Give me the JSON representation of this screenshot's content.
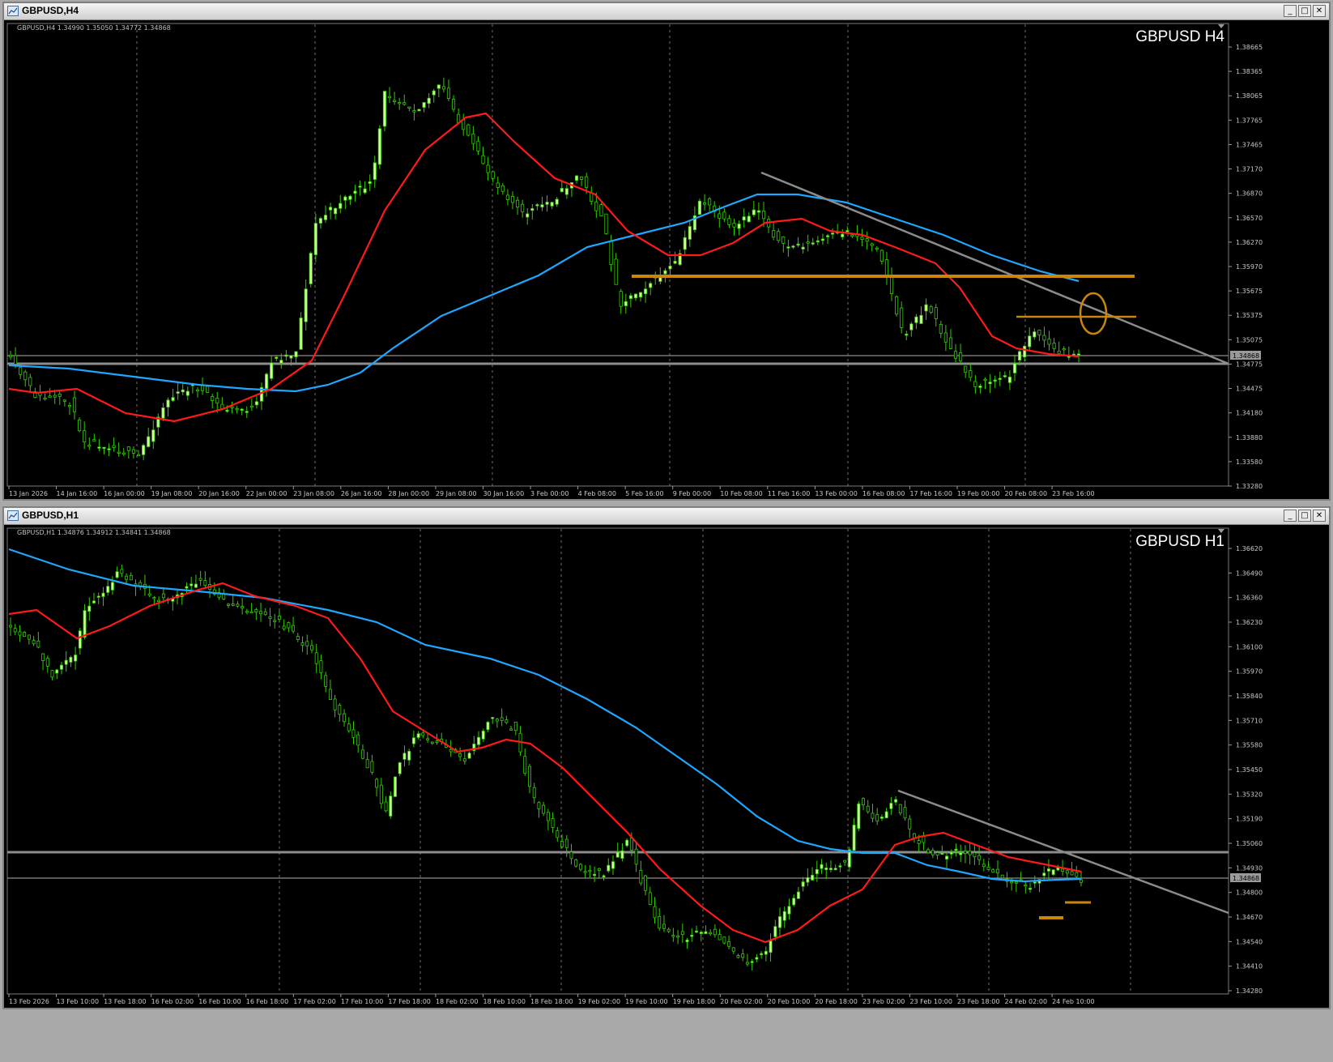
{
  "windows": [
    {
      "title": "GBPUSD,H4",
      "info": "GBPUSD,H4  1.34990 1.35050 1.34772 1.34868",
      "label": "GBPUSD H4",
      "price_ticks": [
        "1.38665",
        "1.38365",
        "1.38065",
        "1.37765",
        "1.37465",
        "1.37170",
        "1.36870",
        "1.36570",
        "1.36270",
        "1.35970",
        "1.35675",
        "1.35375",
        "1.35075",
        "1.34775",
        "1.34475",
        "1.34180",
        "1.33880",
        "1.33580",
        "1.33280"
      ],
      "current_price": "1.34868",
      "time_ticks": [
        "13 Jan 2026",
        "14 Jan 16:00",
        "16 Jan 00:00",
        "19 Jan 08:00",
        "20 Jan 16:00",
        "22 Jan 00:00",
        "23 Jan 08:00",
        "26 Jan 16:00",
        "28 Jan 00:00",
        "29 Jan 08:00",
        "30 Jan 16:00",
        "3 Feb 00:00",
        "4 Feb 08:00",
        "5 Feb 16:00",
        "9 Feb 00:00",
        "10 Feb 08:00",
        "11 Feb 16:00",
        "13 Feb 00:00",
        "16 Feb 08:00",
        "17 Feb 16:00",
        "19 Feb 00:00",
        "20 Feb 08:00",
        "23 Feb 16:00"
      ]
    },
    {
      "title": "GBPUSD,H1",
      "info": "GBPUSD,H1  1.34876 1.34912 1.34841 1.34868",
      "label": "GBPUSD H1",
      "price_ticks": [
        "1.36620",
        "1.36490",
        "1.36360",
        "1.36230",
        "1.36100",
        "1.35970",
        "1.35840",
        "1.35710",
        "1.35580",
        "1.35450",
        "1.35320",
        "1.35190",
        "1.35060",
        "1.34930",
        "1.34800",
        "1.34670",
        "1.34540",
        "1.34410",
        "1.34280"
      ],
      "current_price": "1.34868",
      "time_ticks": [
        "13 Feb 2026",
        "13 Feb 10:00",
        "13 Feb 18:00",
        "16 Feb 02:00",
        "16 Feb 10:00",
        "16 Feb 18:00",
        "17 Feb 02:00",
        "17 Feb 10:00",
        "17 Feb 18:00",
        "18 Feb 02:00",
        "18 Feb 10:00",
        "18 Feb 18:00",
        "19 Feb 02:00",
        "19 Feb 10:00",
        "19 Feb 18:00",
        "20 Feb 02:00",
        "20 Feb 10:00",
        "20 Feb 18:00",
        "23 Feb 02:00",
        "23 Feb 10:00",
        "23 Feb 18:00",
        "24 Feb 02:00",
        "24 Feb 10:00"
      ]
    }
  ],
  "colors": {
    "background": "#000000",
    "bull_candle": "#ccff99",
    "bear_candle": "#000000",
    "wick": "#33cc00",
    "ma_fast": "#ff1a1a",
    "ma_slow": "#1ea7ff",
    "trendline": "#8c8c8c",
    "level_line": "#c8860b",
    "horizontal_support": "#8c8c8c"
  },
  "icons": [
    "chart-window-icon",
    "minimize-icon",
    "maximize-icon",
    "close-icon"
  ]
}
